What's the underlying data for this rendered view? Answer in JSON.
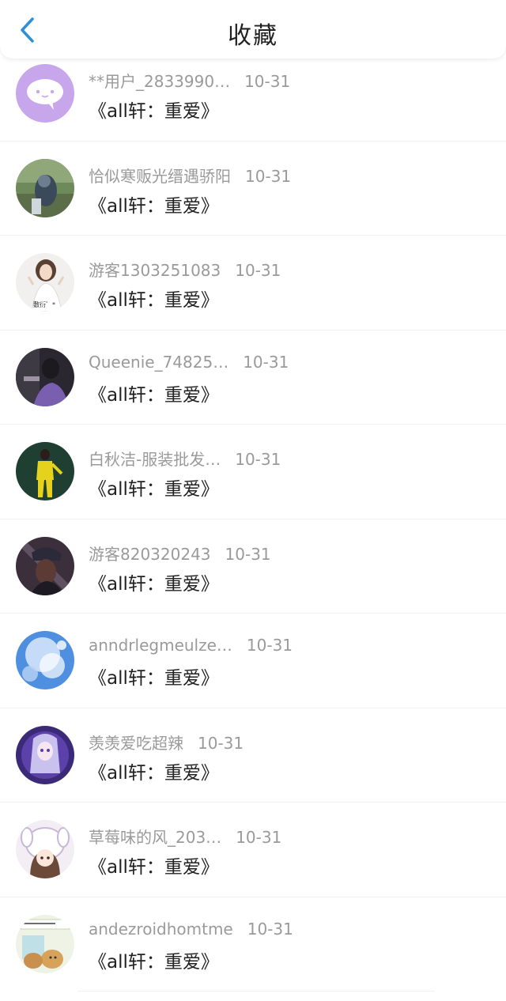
{
  "header": {
    "title": "收藏",
    "back_icon": "chevron-left-icon",
    "accent": "#2f8fd6"
  },
  "items": [
    {
      "user": "**用户_2833990…",
      "date": "10-31",
      "work": "《all轩：重爱》",
      "avatar": "chat-bubble"
    },
    {
      "user": "恰似寒贩光缙遇骄阳",
      "date": "10-31",
      "work": "《all轩：重爱》",
      "avatar": "photo-outdoor"
    },
    {
      "user": "游客1303251083",
      "date": "10-31",
      "work": "《all轩：重爱》",
      "avatar": "photo-portrait",
      "avatar_caption": "敷衍゛*"
    },
    {
      "user": "Queenie_74825…",
      "date": "10-31",
      "work": "《all轩：重爱》",
      "avatar": "photo-dark"
    },
    {
      "user": "白秋洁-服装批发…",
      "date": "10-31",
      "work": "《all轩：重爱》",
      "avatar": "photo-yellow"
    },
    {
      "user": "游客820320243",
      "date": "10-31",
      "work": "《all轩：重爱》",
      "avatar": "photo-cap"
    },
    {
      "user": "anndrlegmeulze…",
      "date": "10-31",
      "work": "《all轩：重爱》",
      "avatar": "photo-sky"
    },
    {
      "user": "羡羡爱吃超辣",
      "date": "10-31",
      "work": "《all轩：重爱》",
      "avatar": "anime-purple"
    },
    {
      "user": "草莓味的风_203…",
      "date": "10-31",
      "work": "《all轩：重爱》",
      "avatar": "anime-cute"
    },
    {
      "user": "andezroidhomtme",
      "date": "10-31",
      "work": "《all轩：重爱》",
      "avatar": "cartoon-green"
    }
  ]
}
